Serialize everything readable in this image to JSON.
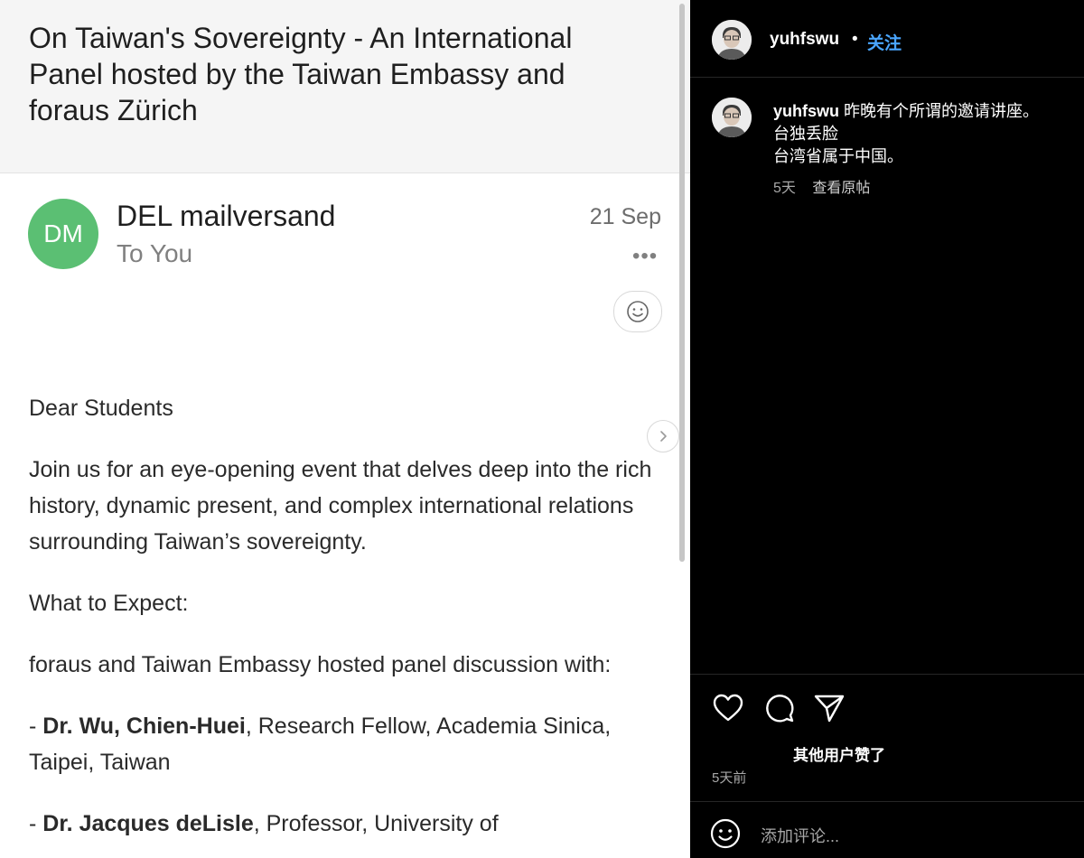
{
  "email": {
    "subject": "On Taiwan's Sovereignty - An International Panel hosted by the Taiwan Embassy and foraus Zürich",
    "sender_initials": "DM",
    "sender_name": "DEL mailversand",
    "recipient": "To You",
    "date": "21 Sep",
    "more_glyph": "•••",
    "greeting": "Dear Students",
    "intro": "Join us for an eye-opening event that delves deep into the rich history, dynamic present, and complex international relations surrounding Taiwan’s sovereignty.",
    "expect_heading": "What to Expect:",
    "panel_line": "foraus and Taiwan Embassy hosted panel discussion with:",
    "speaker1_prefix": "- ",
    "speaker1_name": "Dr. Wu, Chien-Huei",
    "speaker1_rest": ", Research Fellow, Academia Sinica, Taipei, Taiwan",
    "speaker2_prefix": "- ",
    "speaker2_name": "Dr. Jacques deLisle",
    "speaker2_rest": ", Professor, University of"
  },
  "instagram": {
    "username": "yuhfswu",
    "separator": "•",
    "follow_label": "关注",
    "caption_user": "yuhfswu",
    "caption_line1": "昨晚有个所谓的邀请讲座。",
    "caption_line2": "台独丢脸",
    "caption_line3": "台湾省属于中国。",
    "caption_age": "5天",
    "see_original": "查看原帖",
    "likes_text": "其他用户赞了",
    "post_age": "5天前",
    "comment_placeholder": "添加评论..."
  },
  "colors": {
    "avatar_green": "#5bbf73",
    "follow_blue": "#4aa6ff"
  },
  "icons": [
    "smiley-icon",
    "chevron-right-icon",
    "heart-icon",
    "comment-icon",
    "share-icon",
    "emoji-icon"
  ]
}
